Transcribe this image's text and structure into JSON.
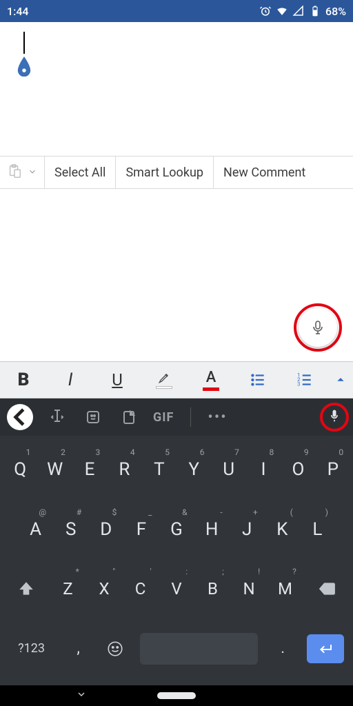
{
  "status": {
    "time": "1:44",
    "battery": "68%"
  },
  "context_menu": {
    "select_all": "Select All",
    "smart_lookup": "Smart Lookup",
    "new_comment": "New Comment"
  },
  "format_bar": {
    "bold": "B",
    "italic": "I",
    "underline": "U",
    "font_color_glyph": "A"
  },
  "keyboard": {
    "gif_label": "GIF",
    "row1": [
      {
        "k": "Q",
        "h": "1"
      },
      {
        "k": "W",
        "h": "2"
      },
      {
        "k": "E",
        "h": "3"
      },
      {
        "k": "R",
        "h": "4"
      },
      {
        "k": "T",
        "h": "5"
      },
      {
        "k": "Y",
        "h": "6"
      },
      {
        "k": "U",
        "h": "7"
      },
      {
        "k": "I",
        "h": "8"
      },
      {
        "k": "O",
        "h": "9"
      },
      {
        "k": "P",
        "h": "0"
      }
    ],
    "row2": [
      {
        "k": "A",
        "h": "@"
      },
      {
        "k": "S",
        "h": "#"
      },
      {
        "k": "D",
        "h": "$"
      },
      {
        "k": "F",
        "h": "_"
      },
      {
        "k": "G",
        "h": "&"
      },
      {
        "k": "H",
        "h": "-"
      },
      {
        "k": "J",
        "h": "+"
      },
      {
        "k": "K",
        "h": "("
      },
      {
        "k": "L",
        "h": ")"
      }
    ],
    "row3": [
      {
        "k": "Z",
        "h": "*"
      },
      {
        "k": "X",
        "h": "\""
      },
      {
        "k": "C",
        "h": "'"
      },
      {
        "k": "V",
        "h": ":"
      },
      {
        "k": "B",
        "h": ";"
      },
      {
        "k": "N",
        "h": "!"
      },
      {
        "k": "M",
        "h": "?"
      }
    ],
    "sym_label": "?123",
    "comma": ",",
    "period": "."
  }
}
